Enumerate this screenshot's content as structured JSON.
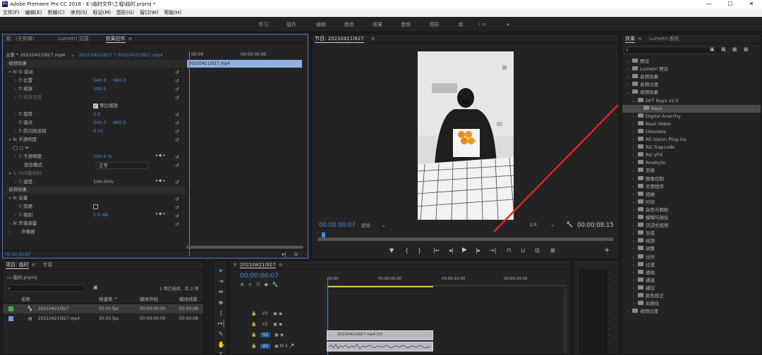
{
  "window": {
    "title": "Adobe Premiere Pro CC 2018 - E:\\临时文件\\工程\\临时.prproj *",
    "app_icon": "Pr",
    "min": "—",
    "max": "☐",
    "close": "✕"
  },
  "menu": [
    "文件(F)",
    "编辑(E)",
    "剪辑(C)",
    "序列(S)",
    "标记(M)",
    "图形(G)",
    "窗口(W)",
    "帮助(H)"
  ],
  "workspaces": [
    "学习",
    "组件",
    "编辑",
    "颜色",
    "效果",
    "音频",
    "图形",
    "库"
  ],
  "workspace_more": "»",
  "effect_controls": {
    "tabs": [
      "源：(无剪辑)",
      "Lumetri 范围",
      "效果控件",
      "≡"
    ],
    "master": "主要 * 20210421l927.mp4",
    "sequence_clip": "20210421l927 * 20210421l927.mp4",
    "time_start": "00:00",
    "time_end": "00:00:05:00",
    "clip_name": "20210421l927.mp4",
    "sections": {
      "video": "视频效果",
      "audio": "音频效果"
    },
    "rows": {
      "motion": "运动",
      "position": "位置",
      "pos_x": "540.0",
      "pos_y": "960.0",
      "scale": "缩放",
      "scale_val": "100.0",
      "scale_width": "缩放宽度",
      "uniform": "等比缩放",
      "rotation": "旋转",
      "rotation_val": "0.0",
      "anchor": "锚点",
      "anchor_x": "540.0",
      "anchor_y": "960.0",
      "antiflicker": "防闪烁滤镜",
      "antiflicker_val": "0.00",
      "opacity": "不透明度",
      "opacity_val": "100.0 %",
      "blend": "混合模式",
      "blend_val": "正常",
      "timeremap": "时间重映射",
      "speed": "速度",
      "speed_val": "100.00%",
      "volume": "音量",
      "bypass": "旁路",
      "level": "级别",
      "level_val": "0.0 dB",
      "channel_vol": "声道音量",
      "panner": "声像器"
    },
    "timecode": "00:00:00:07"
  },
  "program": {
    "title": "节目: 20210421l927",
    "timecode": "00:00:00:07",
    "fit": "适合",
    "quality": "1/4",
    "duration": "00:00:08:15",
    "transport": [
      "▼",
      "{",
      "}",
      "|←",
      "◂|",
      "▶",
      "|▸",
      "→|",
      "⊓",
      "⊔",
      "⊡",
      "⊞",
      "◙",
      "+"
    ]
  },
  "effects_panel": {
    "tabs": [
      "效果",
      "Lumetri 颜色"
    ],
    "items": [
      {
        "label": "预设",
        "level": 0,
        "open": false
      },
      {
        "label": "Lumetri 预设",
        "level": 0,
        "open": false
      },
      {
        "label": "音频效果",
        "level": 0,
        "open": false
      },
      {
        "label": "音频过渡",
        "level": 0,
        "open": false
      },
      {
        "label": "视频效果",
        "level": 0,
        "open": true
      },
      {
        "label": "DFT Rays v2.0",
        "level": 1,
        "open": true
      },
      {
        "label": "Rays",
        "level": 2,
        "open": false,
        "selected": true
      },
      {
        "label": "Digital Anarchy",
        "level": 1,
        "open": false
      },
      {
        "label": "Neat Video",
        "level": 1,
        "open": false
      },
      {
        "label": "Obsolete",
        "level": 1,
        "open": false
      },
      {
        "label": "RE:Vision Plug-ins",
        "level": 1,
        "open": false
      },
      {
        "label": "RG Trapcode",
        "level": 1,
        "open": false
      },
      {
        "label": "RG VFX",
        "level": 1,
        "open": false
      },
      {
        "label": "Rowbyte",
        "level": 1,
        "open": false
      },
      {
        "label": "变换",
        "level": 1,
        "open": false
      },
      {
        "label": "图像控制",
        "level": 1,
        "open": false
      },
      {
        "label": "实用程序",
        "level": 1,
        "open": false
      },
      {
        "label": "扭曲",
        "level": 1,
        "open": false
      },
      {
        "label": "时间",
        "level": 1,
        "open": false
      },
      {
        "label": "杂色与颗粒",
        "level": 1,
        "open": false
      },
      {
        "label": "模糊与锐化",
        "level": 1,
        "open": false
      },
      {
        "label": "沉浸式视频",
        "level": 1,
        "open": false
      },
      {
        "label": "生成",
        "level": 1,
        "open": false
      },
      {
        "label": "视频",
        "level": 1,
        "open": false
      },
      {
        "label": "调整",
        "level": 1,
        "open": false
      },
      {
        "label": "过时",
        "level": 1,
        "open": false
      },
      {
        "label": "过渡",
        "level": 1,
        "open": false
      },
      {
        "label": "透视",
        "level": 1,
        "open": false
      },
      {
        "label": "通道",
        "level": 1,
        "open": false
      },
      {
        "label": "键控",
        "level": 1,
        "open": false
      },
      {
        "label": "颜色校正",
        "level": 1,
        "open": false
      },
      {
        "label": "风格化",
        "level": 1,
        "open": false
      },
      {
        "label": "视频过渡",
        "level": 0,
        "open": false
      }
    ]
  },
  "project": {
    "tabs": [
      "项目: 临时",
      "字幕"
    ],
    "file": "临时.prproj",
    "selection": "1 项已选择，共 2 项",
    "columns": [
      "名称",
      "帧速率 ^",
      "媒体开始",
      "媒体结束"
    ],
    "rows": [
      {
        "name": "20210421l927",
        "fps": "30.00 fps",
        "start": "00:00:00:00",
        "end": "00:00:08"
      },
      {
        "name": "20210421l927.mp4",
        "fps": "30.00 fps",
        "start": "00:00:00:00",
        "end": "00:00:08"
      }
    ]
  },
  "timeline": {
    "tab": "20210421l927",
    "timecode": "00:00:00:07",
    "ruler": [
      ":00:00",
      "00:00:05:00",
      "00:00:10:00",
      "00:00:15:00"
    ],
    "tracks": [
      "V3",
      "V2",
      "V1",
      "A1"
    ],
    "clip_video": "20210421l927.mp4 [V]"
  },
  "colors": {
    "accent": "#3f8fe6",
    "arrow": "#e8202a",
    "clip": "#b9b9c4"
  }
}
